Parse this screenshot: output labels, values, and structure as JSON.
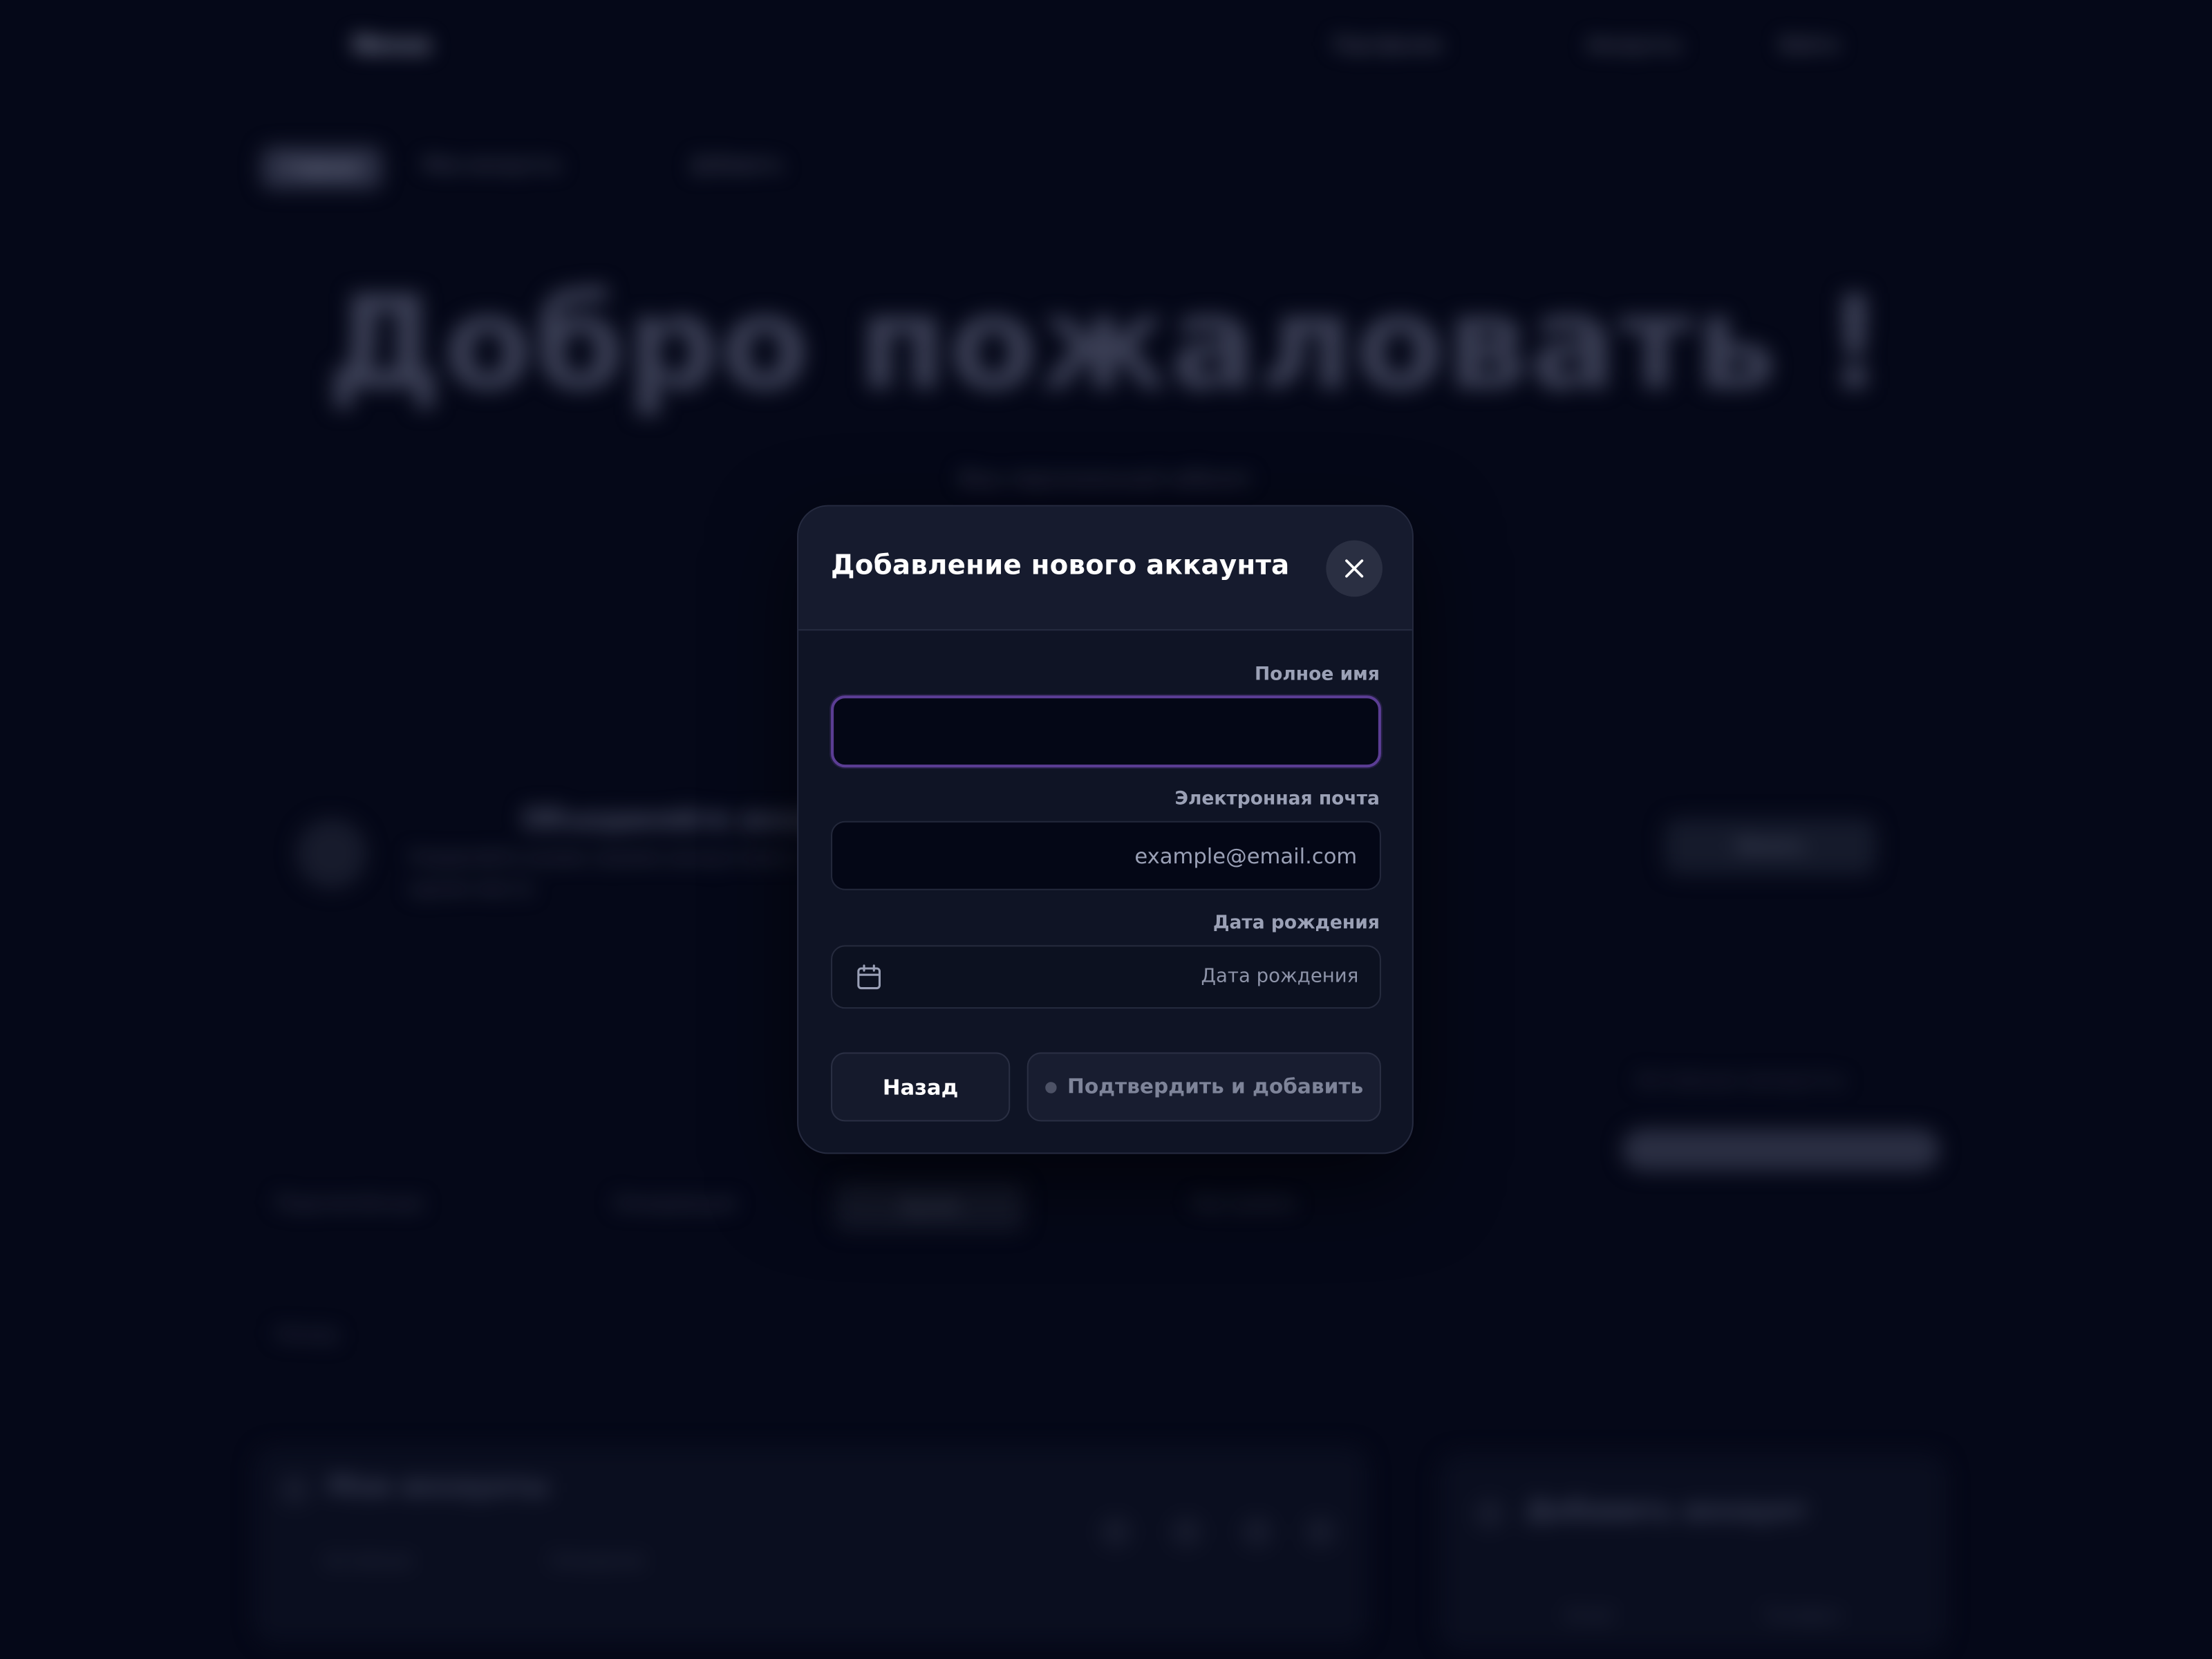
{
  "background": {
    "nav": {
      "logo": "Nexus",
      "items": [
        "Портфолио",
        "Аккаунты",
        "Войти"
      ]
    },
    "chip": "Главная",
    "breadcrumbs": [
      "Мои аккаунты",
      "Добавить"
    ],
    "hero_title": "Добро пожаловать !",
    "hero_subtitle": "Ваш персональный кабинет",
    "promo": {
      "title": "Объединяйте аккаунты",
      "text": "Управляйте всеми своими аккаунтами в одном месте",
      "button": "Начать"
    },
    "right_label": "Активные аккаунты",
    "tabs": [
      "Подключённые",
      "Ожидающие",
      "Архив",
      "Настройки"
    ],
    "back_link": "Назад",
    "cards": [
      {
        "title": "Мои аккаунты",
        "meta": [
          "Активные",
          "Ожидание"
        ]
      },
      {
        "title": "Добавить аккаунт",
        "meta": [
          "Email",
          "Телефон"
        ]
      }
    ]
  },
  "modal": {
    "title": "Добавление нового аккаунта",
    "fields": {
      "full_name": {
        "label": "Полное имя",
        "value": "",
        "placeholder": ""
      },
      "email": {
        "label": "Электронная почта",
        "value": "",
        "placeholder": "example@email.com"
      },
      "birth_date": {
        "label": "Дата рождения",
        "placeholder": "Дата рождения"
      }
    },
    "buttons": {
      "back": "Назад",
      "confirm": "Подтвердить и добавить"
    }
  },
  "icons": {
    "close": "close-icon",
    "calendar": "calendar-icon"
  },
  "colors": {
    "page_background": "#050818",
    "modal_background": "#0f1425",
    "focus_accent": "#5b3d94",
    "text_primary": "#ffffff",
    "text_muted": "#9ba1b6"
  }
}
